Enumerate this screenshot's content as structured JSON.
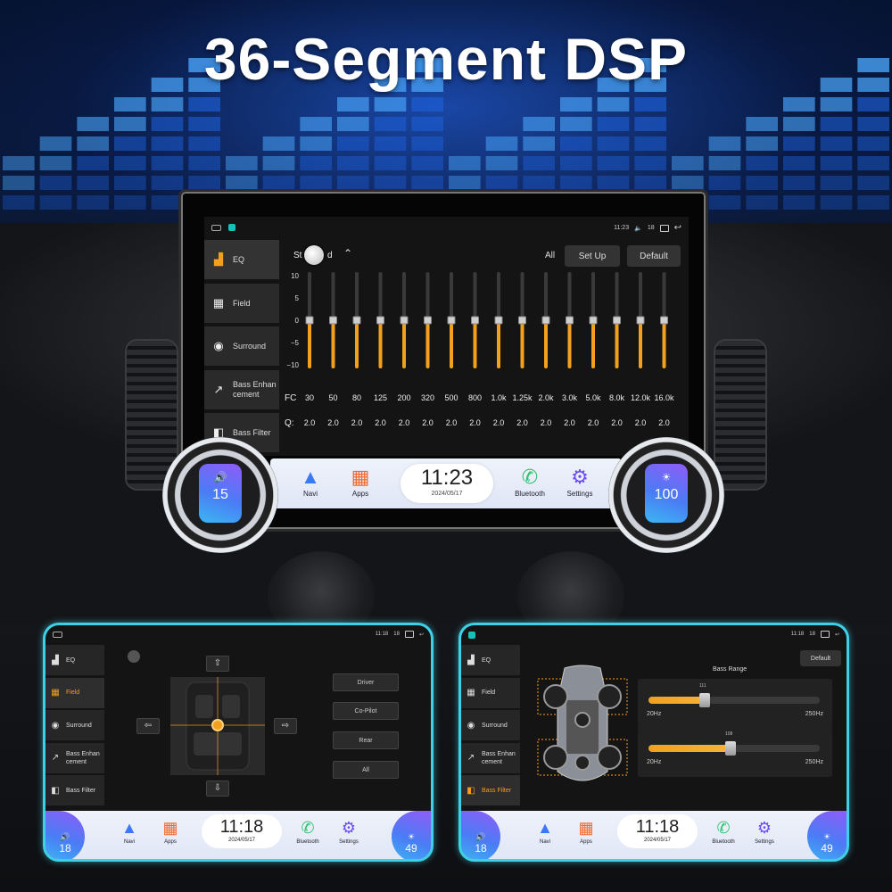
{
  "title": "36-Segment DSP",
  "main": {
    "status": {
      "time": "11:23",
      "volume": "18"
    },
    "sidebar": {
      "items": [
        {
          "label": "EQ",
          "icon": "equalizer-icon"
        },
        {
          "label": "Field",
          "icon": "sound-field-icon"
        },
        {
          "label": "Surround",
          "icon": "surround-icon"
        },
        {
          "label": "Bass Enhancement",
          "label_display": "Bass Enhan\ncement",
          "icon": "bass-enhance-icon"
        },
        {
          "label": "Bass Filter",
          "icon": "bass-filter-icon"
        }
      ]
    },
    "eq": {
      "style_left": "St",
      "style_right": "d",
      "all_label": "All",
      "setup_label": "Set Up",
      "default_label": "Default",
      "fc_label": "FC",
      "q_label": "Q:",
      "y_ticks": [
        "10",
        "5",
        "0",
        "−5",
        "−10"
      ],
      "bands": [
        "30",
        "50",
        "80",
        "125",
        "200",
        "320",
        "500",
        "800",
        "1.0k",
        "1.25k",
        "2.0k",
        "3.0k",
        "5.0k",
        "8.0k",
        "12.0k",
        "16.0k"
      ],
      "q_values": [
        "2.0",
        "2.0",
        "2.0",
        "2.0",
        "2.0",
        "2.0",
        "2.0",
        "2.0",
        "2.0",
        "2.0",
        "2.0",
        "2.0",
        "2.0",
        "2.0",
        "2.0",
        "2.0"
      ],
      "gains": [
        0,
        0,
        0,
        0,
        0,
        0,
        0,
        0,
        0,
        0,
        0,
        0,
        0,
        0,
        0,
        0
      ]
    },
    "dock": {
      "navi": "Navi",
      "apps": "Apps",
      "bluetooth": "Bluetooth",
      "settings": "Settings",
      "clock_time": "11:23",
      "clock_date": "2024/05/17",
      "volume_value": "15",
      "brightness_value": "100"
    }
  },
  "panel_field": {
    "status": {
      "time": "11:18",
      "volume": "18"
    },
    "sidebar": [
      "EQ",
      "Field",
      "Surround",
      "Bass Enhan\ncement",
      "Bass Filter"
    ],
    "active": "Field",
    "seats": [
      "Driver",
      "Co-Pilot",
      "Rear",
      "All"
    ],
    "dock": {
      "navi": "Navi",
      "apps": "Apps",
      "bluetooth": "Bluetooth",
      "settings": "Settings",
      "clock_time": "11:18",
      "clock_date": "2024/05/17",
      "volume_value": "18",
      "brightness_value": "49"
    }
  },
  "panel_bass": {
    "status": {
      "time": "11:18",
      "volume": "18"
    },
    "sidebar": [
      "EQ",
      "Field",
      "Surround",
      "Bass Enhan\ncement",
      "Bass Filter"
    ],
    "active": "Bass Filter",
    "default_label": "Default",
    "range_label": "Bass Range",
    "slider1": {
      "min": "20Hz",
      "max": "250Hz",
      "value_label": "111",
      "fraction": 0.33
    },
    "slider2": {
      "min": "20Hz",
      "max": "250Hz",
      "value_label": "108",
      "fraction": 0.48
    },
    "dock": {
      "navi": "Navi",
      "apps": "Apps",
      "bluetooth": "Bluetooth",
      "settings": "Settings",
      "clock_time": "11:18",
      "clock_date": "2024/05/17",
      "volume_value": "18",
      "brightness_value": "49"
    }
  },
  "colors": {
    "accent": "#f2a01e",
    "panel_border": "#3ed0e6",
    "background_blue": "#1e5fe0"
  }
}
